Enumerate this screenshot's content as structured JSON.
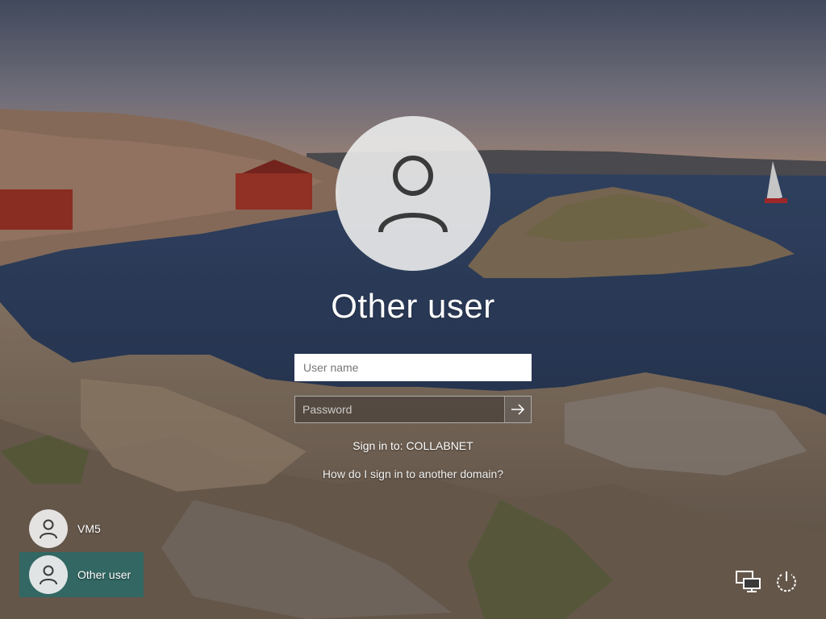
{
  "login": {
    "selected_user_name": "Other user",
    "username_placeholder": "User name",
    "password_placeholder": "Password",
    "sign_in_to": "Sign in to: COLLABNET",
    "domain_help_link": "How do I sign in to another domain?"
  },
  "users": [
    {
      "name": "VM5",
      "selected": false
    },
    {
      "name": "Other user",
      "selected": true
    }
  ],
  "icons": {
    "avatar": "person-icon",
    "submit": "arrow-right-icon",
    "network": "network-icon",
    "power": "power-icon"
  },
  "colors": {
    "selected_tile": "#1e6e6e",
    "avatar_bg": "#e8e8e8"
  }
}
